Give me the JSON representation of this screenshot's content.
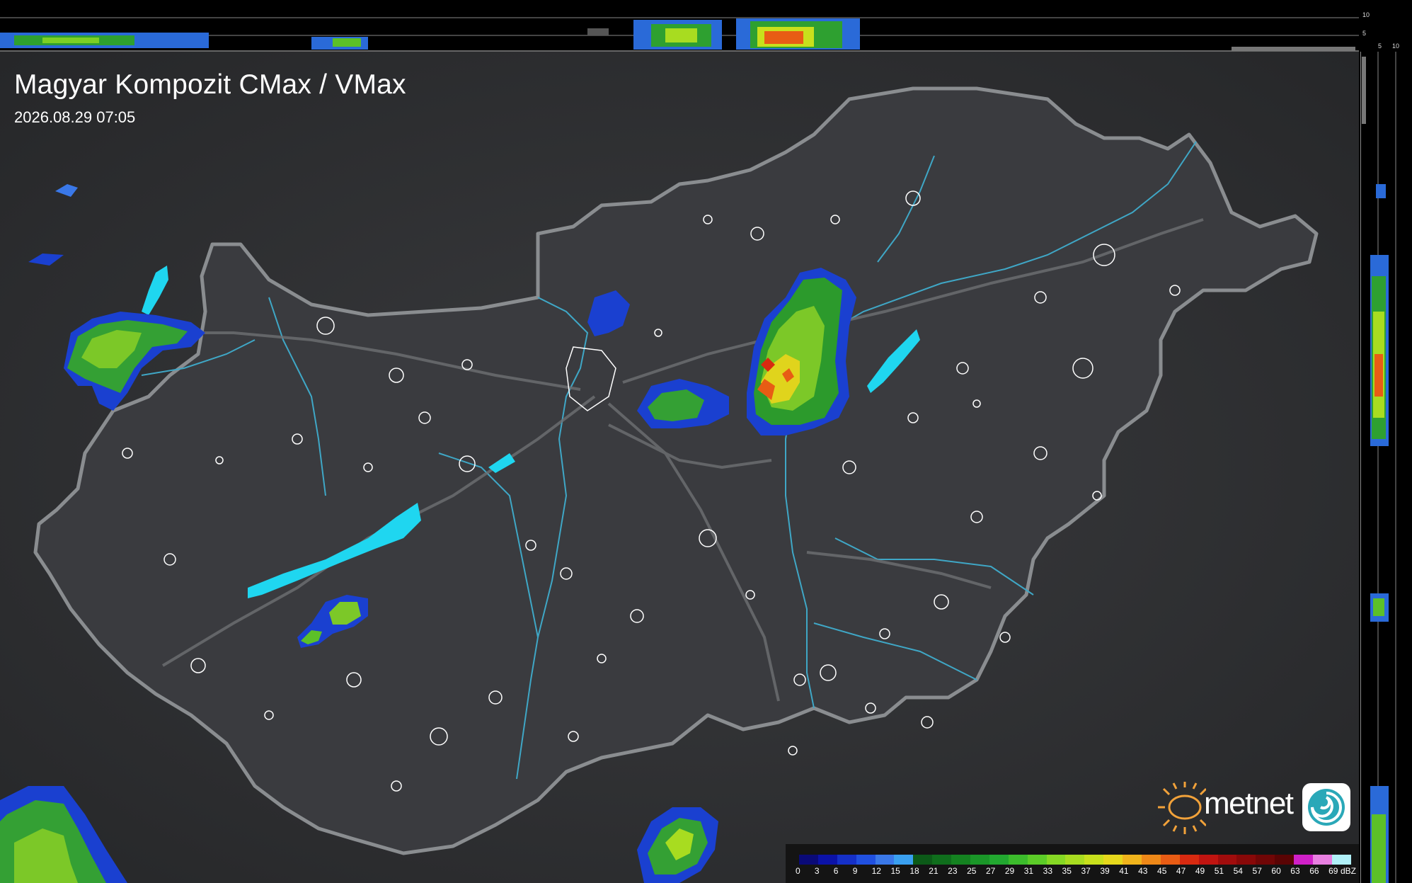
{
  "title": "Magyar Kompozit CMax / VMax",
  "timestamp": "2026.08.29 07:05",
  "logo_text": "metnet",
  "top_scale": [
    "10",
    "5"
  ],
  "side_scale": [
    "5",
    "10"
  ],
  "legend": {
    "unit": "dBZ",
    "levels": [
      "0",
      "3",
      "6",
      "9",
      "12",
      "15",
      "18",
      "21",
      "23",
      "25",
      "27",
      "29",
      "31",
      "33",
      "35",
      "37",
      "39",
      "41",
      "43",
      "45",
      "47",
      "49",
      "51",
      "54",
      "57",
      "60",
      "63",
      "66",
      "69"
    ],
    "colors": [
      "#0a0a78",
      "#0b12a8",
      "#1530c8",
      "#2050e0",
      "#3a78e8",
      "#3aa0f0",
      "#0c5a18",
      "#0f6e1c",
      "#148220",
      "#1a9628",
      "#22a830",
      "#3cbc2c",
      "#5ccc28",
      "#86d824",
      "#a8dc20",
      "#c8e01c",
      "#e6d81c",
      "#f0b41c",
      "#ee8818",
      "#e85c14",
      "#d82a10",
      "#c01410",
      "#a00c0c",
      "#880808",
      "#700606",
      "#5a0404",
      "#d020c8",
      "#e880e0",
      "#b0f0f8"
    ]
  },
  "icons": {
    "logo_sun": "sun-logo-icon",
    "logo_badge": "metnet-swirl-icon"
  }
}
